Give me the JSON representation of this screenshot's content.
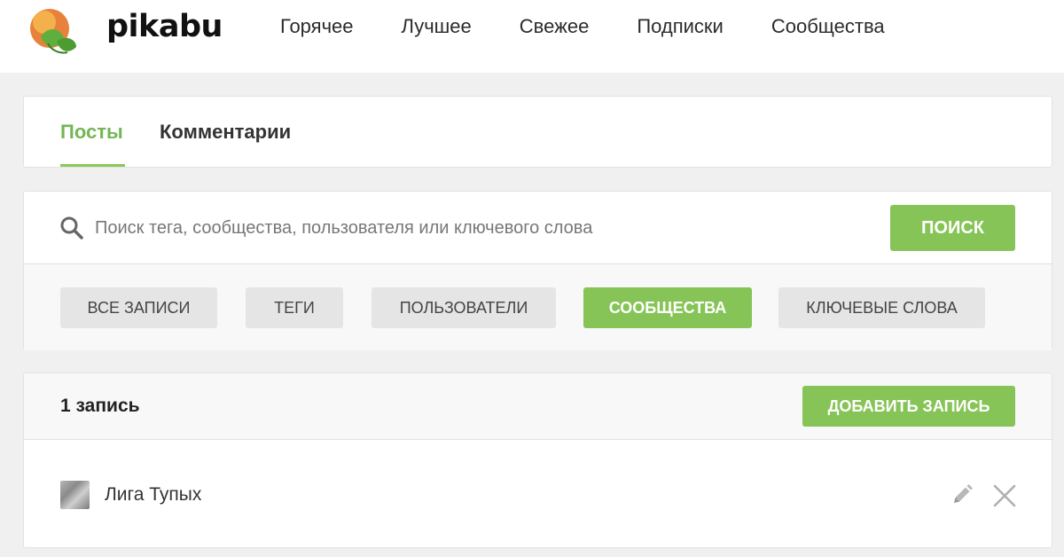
{
  "brand": {
    "name": "pikabu"
  },
  "nav": {
    "items": [
      "Горячее",
      "Лучшее",
      "Свежее",
      "Подписки",
      "Сообщества"
    ]
  },
  "tabs": [
    {
      "label": "Посты",
      "active": true
    },
    {
      "label": "Комментарии",
      "active": false
    }
  ],
  "search": {
    "placeholder": "Поиск тега, сообщества, пользователя или ключевого слова",
    "value": "",
    "button_label": "ПОИСК",
    "icon": "search-icon"
  },
  "filters": [
    {
      "label": "ВСЕ ЗАПИСИ",
      "active": false
    },
    {
      "label": "ТЕГИ",
      "active": false
    },
    {
      "label": "ПОЛЬЗОВАТЕЛИ",
      "active": false
    },
    {
      "label": "СООБЩЕСТВА",
      "active": true
    },
    {
      "label": "КЛЮЧЕВЫЕ СЛОВА",
      "active": false
    }
  ],
  "records": {
    "count_label": "1 запись",
    "add_button_label": "ДОБАВИТЬ ЗАПИСЬ",
    "items": [
      {
        "name": "Лига Тупых",
        "icons": [
          "pencil-icon",
          "close-icon"
        ]
      }
    ]
  },
  "colors": {
    "accent": "#86c457",
    "accent_text": "#73b655",
    "background": "#f0f0f0",
    "chip": "#e5e5e5"
  }
}
